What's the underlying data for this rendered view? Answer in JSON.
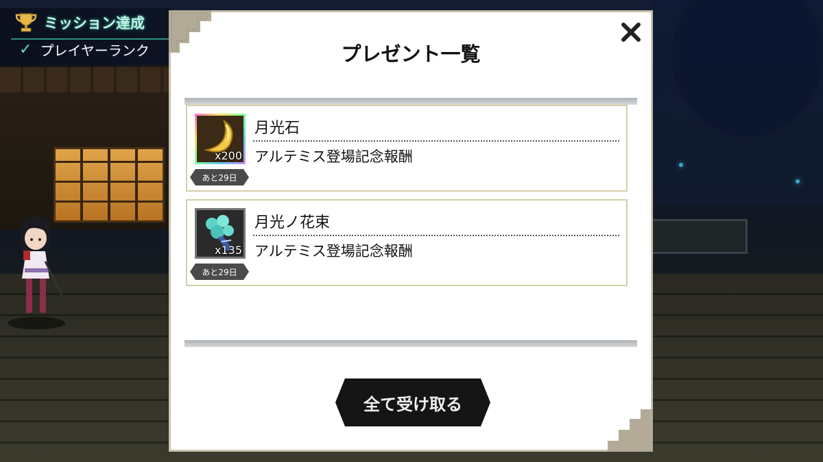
{
  "hud": {
    "mission_title": "ミッション達成",
    "mission_item": "プレイヤーランク",
    "icons": [
      "trophy-icon",
      "check-icon"
    ],
    "accent_color": "#bff3e6"
  },
  "modal": {
    "title": "プレゼント一覧",
    "close_icon": "close-icon",
    "items": [
      {
        "name": "月光石",
        "description": "アルテミス登場記念報酬",
        "quantity": "x200",
        "expires": "あと29日",
        "icon": "moonstone-icon"
      },
      {
        "name": "月光ノ花束",
        "description": "アルテミス登場記念報酬",
        "quantity": "x135",
        "expires": "あと29日",
        "icon": "bouquet-icon"
      }
    ],
    "receive_all_label": "全て受け取る"
  }
}
